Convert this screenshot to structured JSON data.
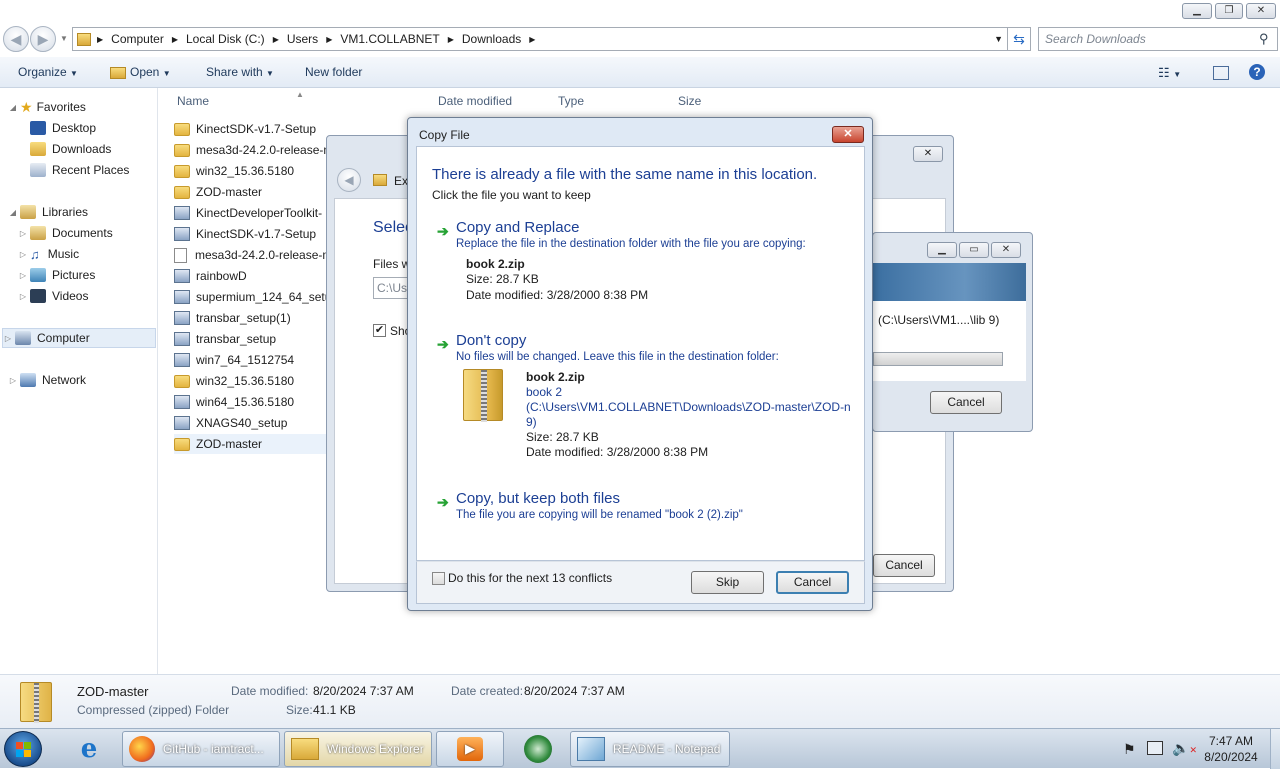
{
  "address": {
    "segments": [
      "Computer",
      "Local Disk (C:)",
      "Users",
      "VM1.COLLABNET",
      "Downloads"
    ],
    "search_placeholder": "Search Downloads"
  },
  "toolbar": {
    "organize": "Organize",
    "open": "Open",
    "share": "Share with",
    "new_folder": "New folder"
  },
  "nav": {
    "favorites": "Favorites",
    "desktop": "Desktop",
    "downloads": "Downloads",
    "recent": "Recent Places",
    "libraries": "Libraries",
    "documents": "Documents",
    "music": "Music",
    "pictures": "Pictures",
    "videos": "Videos",
    "computer": "Computer",
    "network": "Network"
  },
  "columns": {
    "name": "Name",
    "date": "Date modified",
    "type": "Type",
    "size": "Size"
  },
  "files": [
    {
      "name": "KinectSDK-v1.7-Setup",
      "kind": "folder"
    },
    {
      "name": "mesa3d-24.2.0-release-m",
      "kind": "folder"
    },
    {
      "name": "win32_15.36.5180",
      "kind": "folder"
    },
    {
      "name": "ZOD-master",
      "kind": "folder"
    },
    {
      "name": "KinectDeveloperToolkit-",
      "kind": "exe"
    },
    {
      "name": "KinectSDK-v1.7-Setup",
      "kind": "exe"
    },
    {
      "name": "mesa3d-24.2.0-release-m",
      "kind": "doc"
    },
    {
      "name": "rainbowD",
      "kind": "exe"
    },
    {
      "name": "supermium_124_64_setu",
      "kind": "exe"
    },
    {
      "name": "transbar_setup(1)",
      "kind": "exe"
    },
    {
      "name": "transbar_setup",
      "kind": "exe"
    },
    {
      "name": "win7_64_1512754",
      "kind": "exe"
    },
    {
      "name": "win32_15.36.5180",
      "kind": "folder"
    },
    {
      "name": "win64_15.36.5180",
      "kind": "exe"
    },
    {
      "name": "XNAGS40_setup",
      "kind": "exe"
    },
    {
      "name": "ZOD-master",
      "kind": "folder"
    }
  ],
  "details": {
    "name": "ZOD-master",
    "type": "Compressed (zipped) Folder",
    "modified_label": "Date modified:",
    "modified": "8/20/2024 7:37 AM",
    "created_label": "Date created:",
    "created": "8/20/2024 7:37 AM",
    "size_label": "Size:",
    "size": "41.1 KB"
  },
  "extract_dialog": {
    "title_partial": "Ext",
    "select_partial": "Selec",
    "files_partial": "Files w",
    "path_partial": "C:\\Us",
    "show_partial": "Sho",
    "cancel": "Cancel"
  },
  "progress_dialog": {
    "path": "(C:\\Users\\VM1....\\lib 9)",
    "cancel": "Cancel"
  },
  "copy_dialog": {
    "title": "Copy File",
    "heading": "There is already a file with the same name in this location.",
    "subheading": "Click the file you want to keep",
    "replace_title": "Copy and Replace",
    "replace_desc": "Replace the file in the destination folder with the file you are copying:",
    "replace_file": "book 2.zip",
    "replace_size": "Size: 28.7 KB",
    "replace_date": "Date modified: 3/28/2000 8:38 PM",
    "dontcopy_title": "Don't copy",
    "dontcopy_desc": "No files will be changed. Leave this file in the destination folder:",
    "dontcopy_file": "book 2.zip",
    "dontcopy_name": "book 2",
    "dontcopy_path1": "(C:\\Users\\VM1.COLLABNET\\Downloads\\ZOD-master\\ZOD-n",
    "dontcopy_path2": "9)",
    "dontcopy_size": "Size: 28.7 KB",
    "dontcopy_date": "Date modified: 3/28/2000 8:38 PM",
    "both_title": "Copy, but keep both files",
    "both_desc": "The file you are copying will be renamed \"book 2 (2).zip\"",
    "checkbox_label": "Do this for the next 13 conflicts",
    "skip": "Skip",
    "cancel": "Cancel"
  },
  "taskbar": {
    "tasks": [
      "GitHub - iamtract...",
      "Windows Explorer",
      "",
      "",
      "README - Notepad"
    ],
    "time": "7:47 AM",
    "date": "8/20/2024"
  },
  "colors": {
    "accent": "#1c3f94",
    "arrow": "#27a335"
  }
}
